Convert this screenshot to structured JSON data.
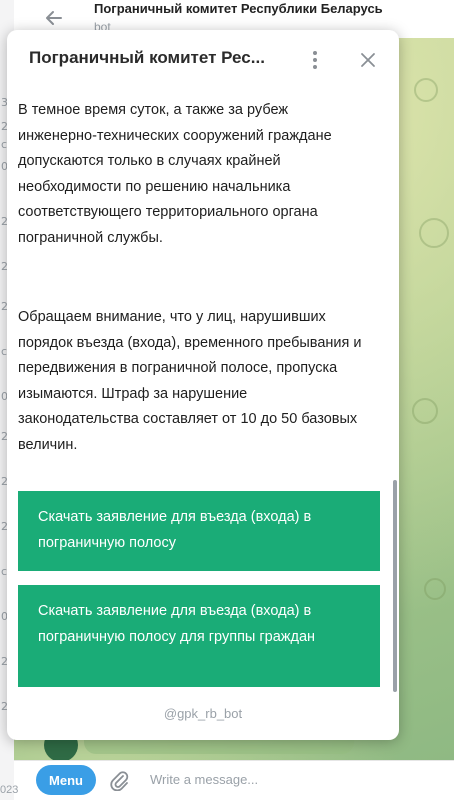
{
  "chat": {
    "title": "Пограничный комитет Республики Беларусь",
    "subtitle": "bot"
  },
  "popup": {
    "title": "Пограничный комитет Рес...",
    "paragraphs": [
      "В темное время суток, а также за рубеж инженерно-технических сооружений граждане допускаются только в случаях крайней необходимости по решению начальника соответствующего территориального органа пограничной службы.",
      "Обращаем внимание, что у лиц, нарушивших порядок въезда (входа), временного пребывания и передвижения в пограничной полосе, пропуска изымаются. Штраф за нарушение законодательства составляет от 10 до 50 базовых величин."
    ],
    "buttons": [
      "Скачать заявление для въезда (входа) в пограничную полосу",
      "Скачать заявление для въезда (входа) в пограничную полосу для группы граждан"
    ],
    "footer": "@gpk_rb_bot"
  },
  "composer": {
    "menu_label": "Menu",
    "placeholder": "Write a message..."
  },
  "left_list": {
    "fragments": [
      "3",
      "2",
      "с",
      "0",
      "2",
      "2",
      "2",
      "с",
      "0",
      "2",
      "2",
      "2",
      "с",
      "0",
      "2",
      "2"
    ],
    "year": "023"
  },
  "colors": {
    "accent_button": "#1aac77",
    "menu_button": "#3a9ee6"
  }
}
